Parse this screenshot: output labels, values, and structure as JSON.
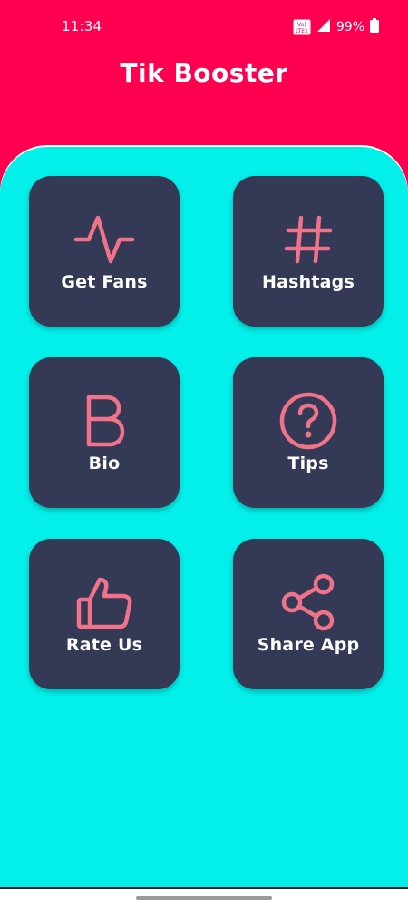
{
  "status_bar": {
    "time": "11:34",
    "volte_icon": "volte-lte-icon",
    "signal_icon": "cell-signal-icon",
    "battery_percent": "99%",
    "battery_icon": "battery-icon"
  },
  "app": {
    "title": "Tik Booster"
  },
  "menu": {
    "items": [
      {
        "label": "Get Fans",
        "icon": "pulse-icon"
      },
      {
        "label": "Hashtags",
        "icon": "hashtag-icon"
      },
      {
        "label": "Bio",
        "icon": "letter-b-icon"
      },
      {
        "label": "Tips",
        "icon": "question-circle-icon"
      },
      {
        "label": "Rate Us",
        "icon": "thumbs-up-icon"
      },
      {
        "label": "Share App",
        "icon": "share-icon"
      }
    ]
  },
  "colors": {
    "header_background": "#FF0050",
    "panel_background": "#03F0EA",
    "tile_background": "#343955",
    "icon_color": "#F0738A",
    "text_color": "#FFFFFF"
  }
}
